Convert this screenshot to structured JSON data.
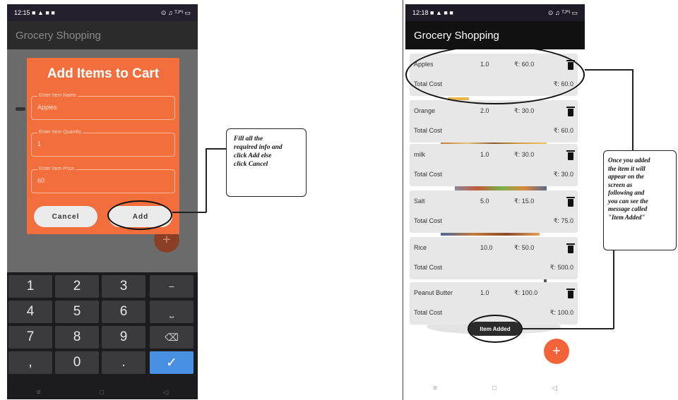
{
  "left_phone": {
    "status_time": "12:15",
    "status_icons": "■ ▲ ■ ■",
    "status_right": "⊙ ♫ ᵀᴶ°ᴵ ▭",
    "app_title": "Grocery Shopping",
    "dialog": {
      "title": "Add Items to Cart",
      "fields": [
        {
          "label": "Enter Item Name",
          "value": "Apples"
        },
        {
          "label": "Enter Item Quantity",
          "value": "1"
        },
        {
          "label": "Enter Item Price",
          "value": "60"
        }
      ],
      "cancel_label": "Cancel",
      "add_label": "Add"
    },
    "fab_label": "+",
    "keyboard": {
      "rows": [
        [
          "1",
          "2",
          "3",
          "−"
        ],
        [
          "4",
          "5",
          "6",
          "⎵"
        ],
        [
          "7",
          "8",
          "9",
          "⌫"
        ],
        [
          ",",
          "0",
          ".",
          "✓"
        ]
      ]
    },
    "nav": [
      "≡",
      "□",
      "◁"
    ]
  },
  "right_phone": {
    "status_time": "12:18",
    "status_icons": "■ ▲ ■ ■",
    "status_right": "⊙ ♫ ᵀᴶ°ᴵ ▭",
    "app_title": "Grocery Shopping",
    "items": [
      {
        "name": "Apples",
        "qty": "1.0",
        "price": "₹: 60.0",
        "total_label": "Total Cost",
        "total": "₹: 60.0"
      },
      {
        "name": "Orange",
        "qty": "2.0",
        "price": "₹: 30.0",
        "total_label": "Total Cost",
        "total": "₹: 60.0"
      },
      {
        "name": "milk",
        "qty": "1.0",
        "price": "₹: 30.0",
        "total_label": "Total Cost",
        "total": "₹: 30.0"
      },
      {
        "name": "Salt",
        "qty": "5.0",
        "price": "₹: 15.0",
        "total_label": "Total Cost",
        "total": "₹: 75.0"
      },
      {
        "name": "Rice",
        "qty": "10.0",
        "price": "₹: 50.0",
        "total_label": "Total Cost",
        "total": "₹: 500.0"
      },
      {
        "name": "Peanut Butter",
        "qty": "1.0",
        "price": "₹: 100.0",
        "total_label": "Total Cost",
        "total": "₹: 100.0"
      }
    ],
    "toast": "Item Added",
    "fab_label": "+",
    "nav": [
      "≡",
      "□",
      "◁"
    ]
  },
  "callouts": {
    "left": [
      "Fill all the",
      "required info and",
      "click Add else",
      "click Cancel"
    ],
    "right": [
      "Once you added",
      "the item it will",
      "appear on the",
      "screen as",
      "following and",
      "you can see the",
      "message called",
      "\"Item Added\""
    ]
  },
  "colors": {
    "dialog": "#f26e3c",
    "fab": "#f2633a",
    "done_key": "#4a90e2"
  }
}
